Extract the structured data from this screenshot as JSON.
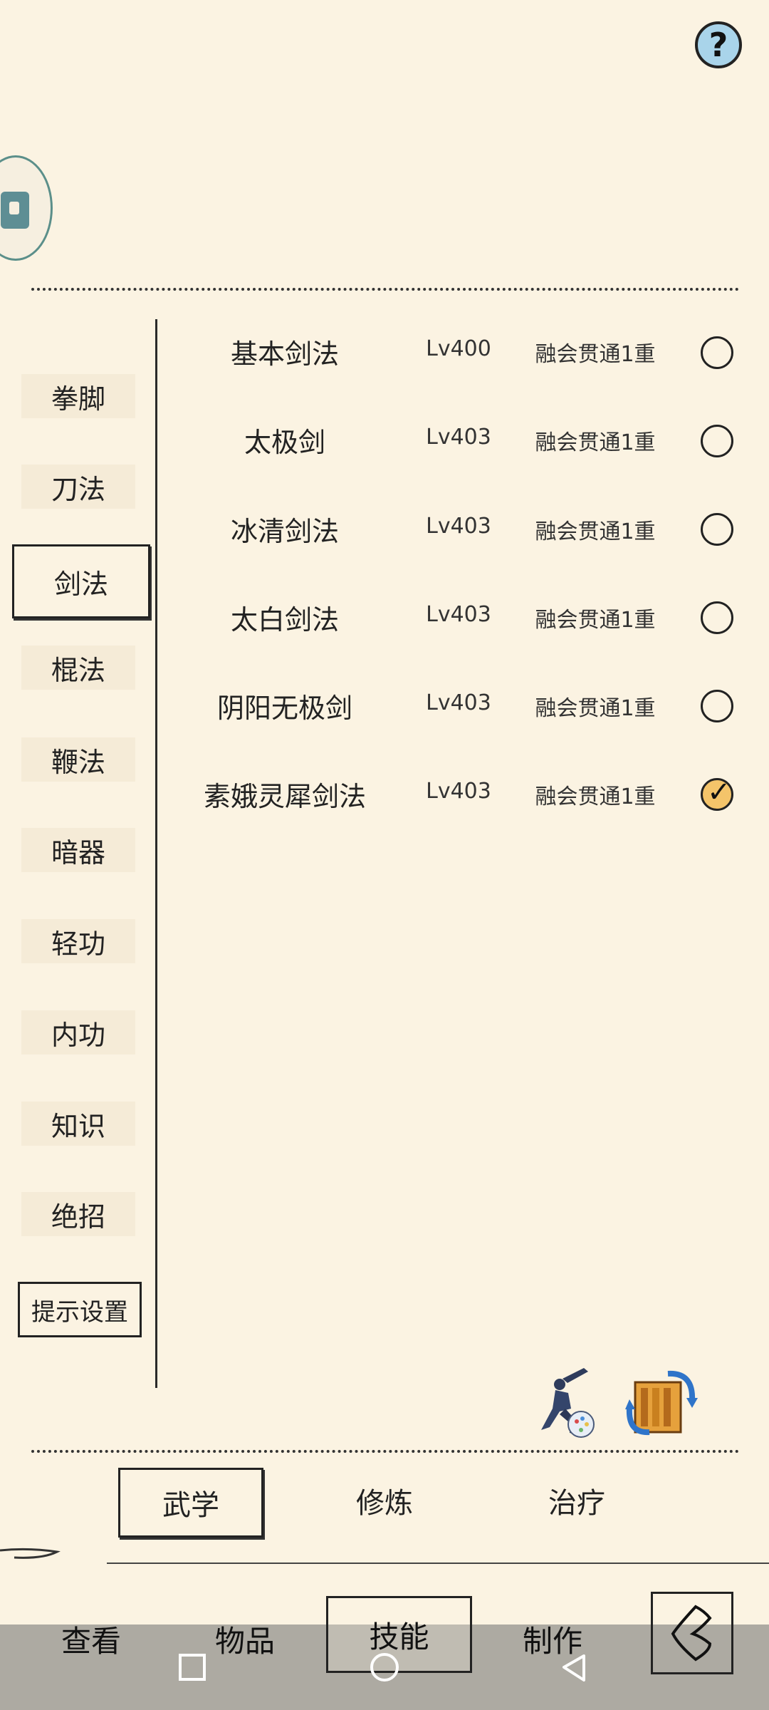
{
  "header": {
    "help_label": "?"
  },
  "categories": [
    {
      "label": "拳脚",
      "active": false
    },
    {
      "label": "刀法",
      "active": false
    },
    {
      "label": "剑法",
      "active": true
    },
    {
      "label": "棍法",
      "active": false
    },
    {
      "label": "鞭法",
      "active": false
    },
    {
      "label": "暗器",
      "active": false
    },
    {
      "label": "轻功",
      "active": false
    },
    {
      "label": "内功",
      "active": false
    },
    {
      "label": "知识",
      "active": false
    },
    {
      "label": "绝招",
      "active": false
    }
  ],
  "tips_button": "提示设置",
  "skills": [
    {
      "name": "基本剑法",
      "level": "Lv400",
      "status": "融会贯通1重",
      "checked": false
    },
    {
      "name": "太极剑",
      "level": "Lv403",
      "status": "融会贯通1重",
      "checked": false
    },
    {
      "name": "冰清剑法",
      "level": "Lv403",
      "status": "融会贯通1重",
      "checked": false
    },
    {
      "name": "太白剑法",
      "level": "Lv403",
      "status": "融会贯通1重",
      "checked": false
    },
    {
      "name": "阴阳无极剑",
      "level": "Lv403",
      "status": "融会贯通1重",
      "checked": false
    },
    {
      "name": "素娥灵犀剑法",
      "level": "Lv403",
      "status": "融会贯通1重",
      "checked": true
    }
  ],
  "sub_tabs": [
    {
      "label": "武学",
      "active": true
    },
    {
      "label": "修炼",
      "active": false
    },
    {
      "label": "治疗",
      "active": false
    }
  ],
  "nav_tabs": [
    {
      "label": "查看",
      "active": false
    },
    {
      "label": "物品",
      "active": false
    },
    {
      "label": "技能",
      "active": true
    },
    {
      "label": "制作",
      "active": false
    }
  ],
  "colors": {
    "background": "#fbf3e2",
    "help_fill": "#a9d4ea",
    "checked_fill": "#f4c46a"
  }
}
